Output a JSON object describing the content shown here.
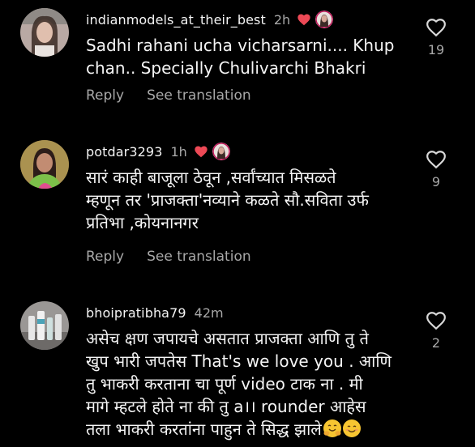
{
  "comments": [
    {
      "username": "indianmodels_at_their_best",
      "time": "2h",
      "text": "Sadhi rahani ucha vicharsarni.... Khup chan.. Specially Chulivarchi Bhakri",
      "likes": "19",
      "reply_label": "Reply",
      "translate_label": "See translation"
    },
    {
      "username": "potdar3293",
      "time": "1h",
      "text": "सारं काही बाजूला ठेवून ,सर्वांच्यात मिसळते\nम्हणून तर 'प्राजक्ता'नव्याने कळते  सौ.सविता उर्फ\nप्रतिभा ,कोयनानगर",
      "likes": "9",
      "reply_label": "Reply",
      "translate_label": "See translation"
    },
    {
      "username": "bhoipratibha79",
      "time": "42m",
      "text": "असेच क्षण जपायचे असतात प्राजक्ता आणि तु ते\nखुप भारी जपतेस That's we love you . आणि\nतु भाकरी करताना चा पूर्ण video टाक ना . मी\nमागे म्हटले होते ना की तु a।। rounder आहेस\nतला भाकरी करतांना पाहुन ते सिद्ध झाले",
      "likes": "2"
    }
  ],
  "colors": {
    "background": "#000000",
    "text": "#f5f5f5",
    "secondary": "#a8a8a8",
    "heart_red": "#ed4956"
  }
}
